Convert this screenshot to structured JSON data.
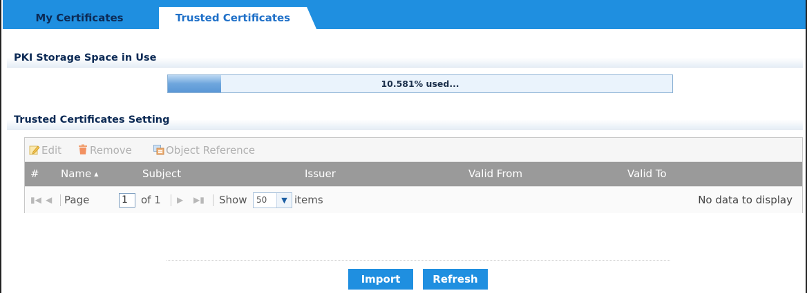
{
  "tabs": [
    {
      "label": "My Certificates",
      "active": false
    },
    {
      "label": "Trusted Certificates",
      "active": true
    }
  ],
  "pki": {
    "title": "PKI Storage Space in Use",
    "used_percent": 10.581,
    "usage_text": "10.581% used..."
  },
  "trusted_setting": {
    "title": "Trusted Certificates Setting"
  },
  "toolbar": {
    "edit_label": "Edit",
    "remove_label": "Remove",
    "object_reference_label": "Object Reference"
  },
  "table": {
    "columns": [
      "#",
      "Name",
      "Subject",
      "Issuer",
      "Valid From",
      "Valid To"
    ],
    "sort_column": "Name",
    "rows": []
  },
  "pager": {
    "page_label": "Page",
    "current_page": "1",
    "of_label": "of 1",
    "show_label": "Show",
    "page_size": "50",
    "items_label": "items",
    "empty_message": "No data to display"
  },
  "buttons": {
    "import_label": "Import",
    "refresh_label": "Refresh"
  },
  "colors": {
    "accent": "#1f8fe0",
    "heading": "#0c2a55",
    "header_row": "#9a9a9a"
  }
}
